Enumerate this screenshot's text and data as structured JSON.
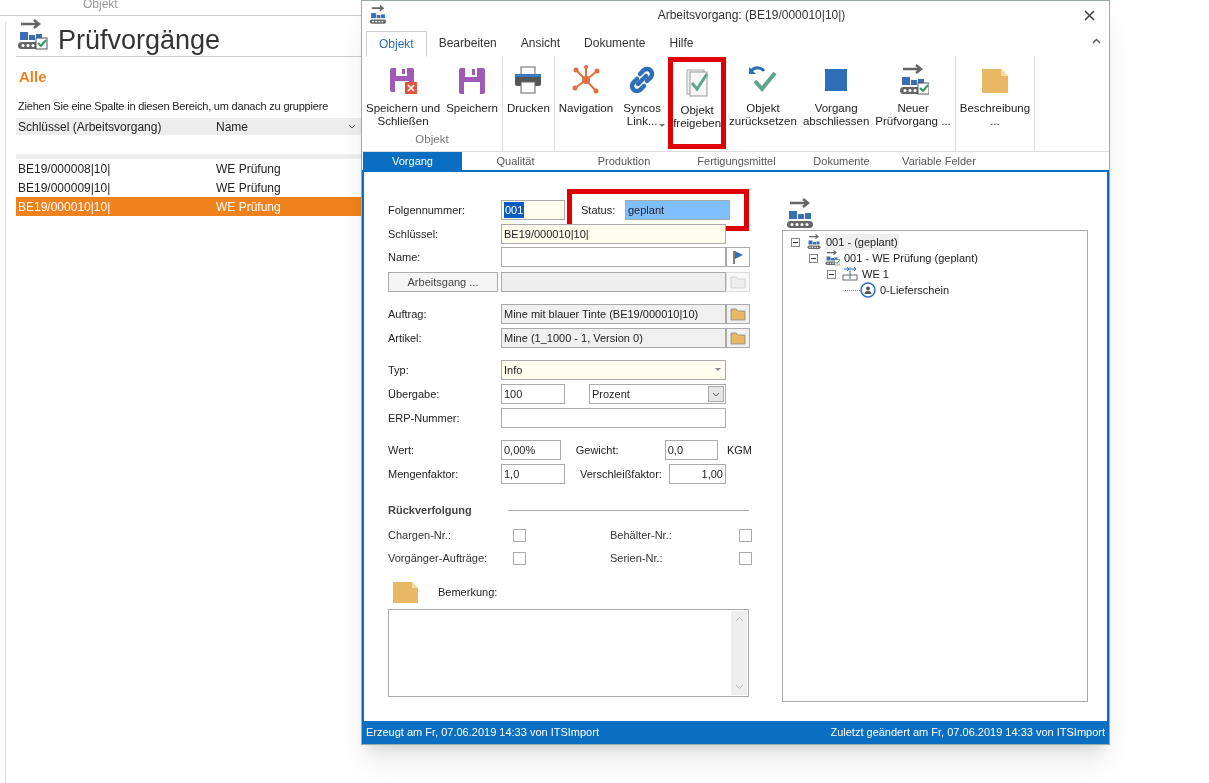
{
  "background": {
    "header_tab": "Objekt",
    "title": "Prüfvorgänge",
    "filter": "Alle",
    "group_hint": "Ziehen Sie eine Spalte in diesen Bereich, um danach zu gruppiere",
    "columns": [
      "Schlüssel (Arbeitsvorgang)",
      "Name"
    ],
    "rows": [
      {
        "cells": [
          "BE19/000008|10|",
          "WE Prüfung"
        ],
        "selected": false
      },
      {
        "cells": [
          "BE19/000009|10|",
          "WE Prüfung"
        ],
        "selected": false
      },
      {
        "cells": [
          "BE19/000010|10|",
          "WE Prüfung"
        ],
        "selected": true
      }
    ]
  },
  "dialog": {
    "title": "Arbeitsvorgang:  (BE19/000010|10|)",
    "ribbon_tabs": [
      {
        "label": "Objekt",
        "selected": true
      },
      {
        "label": "Bearbeiten",
        "selected": false
      },
      {
        "label": "Ansicht",
        "selected": false
      },
      {
        "label": "Dokumente",
        "selected": false
      },
      {
        "label": "Hilfe",
        "selected": false
      }
    ],
    "ribbon_groups": [
      {
        "label": "Objekt",
        "buttons": [
          {
            "kind": "save_close",
            "label": "Speichern und\nSchließen",
            "highlighted": false
          },
          {
            "kind": "save",
            "label": "Speichern",
            "highlighted": false
          }
        ]
      },
      {
        "buttons": [
          {
            "kind": "print",
            "label": "Drucken",
            "highlighted": false
          }
        ]
      },
      {
        "buttons": [
          {
            "kind": "navigation",
            "label": "Navigation",
            "highlighted": false
          },
          {
            "kind": "link",
            "label": "Syncos\nLink...",
            "dropdown": true,
            "highlighted": false
          },
          {
            "kind": "release",
            "label": "Objekt\nfreigeben",
            "highlighted": true
          },
          {
            "kind": "reset",
            "label": "Objekt\nzurücksetzen",
            "highlighted": false
          },
          {
            "kind": "finish",
            "label": "Vorgang\nabschliessen",
            "highlighted": false
          },
          {
            "kind": "new",
            "label": "Neuer\nPrüfvorgang ...",
            "highlighted": false
          }
        ]
      },
      {
        "buttons": [
          {
            "kind": "note",
            "label": "Beschreibung\n...",
            "highlighted": false
          }
        ]
      }
    ],
    "sub_tabs": [
      {
        "label": "Vorgang",
        "selected": true
      },
      {
        "label": "Qualität",
        "selected": false
      },
      {
        "label": "Produktion",
        "selected": false
      },
      {
        "label": "Fertigungsmittel",
        "selected": false
      },
      {
        "label": "Dokumente",
        "selected": false
      },
      {
        "label": "Variable Felder",
        "selected": false
      }
    ],
    "form": {
      "sequence": {
        "label": "Folgennummer:",
        "value": "001"
      },
      "status": {
        "label": "Status:",
        "value": "geplant",
        "highlighted": true
      },
      "key": {
        "label": "Schlüssel:",
        "value": "BE19/000010|10|"
      },
      "name": {
        "label": "Name:"
      },
      "operation_button": "Arbeitsgang ...",
      "order": {
        "label": "Auftrag:",
        "value": "Mine mit blauer Tinte (BE19/000010|10)"
      },
      "article": {
        "label": "Artikel:",
        "value": "Mine (1_1000 - 1, Version 0)"
      },
      "type": {
        "label": "Typ:",
        "value": "Info"
      },
      "transfer": {
        "label": "Übergabe:",
        "value": "100",
        "unit": "Prozent"
      },
      "erp": {
        "label": "ERP-Nummer:"
      },
      "worth": {
        "label": "Wert:",
        "value": "0,00%"
      },
      "weight": {
        "label": "Gewicht:",
        "value": "0,0",
        "unit": "KGM"
      },
      "quantity_factor": {
        "label": "Mengenfaktor:",
        "value": "1,0"
      },
      "wear_factor": {
        "label": "Verschleißfaktor:",
        "value": "1,00"
      },
      "traceability": {
        "title": "Rückverfolgung",
        "options": [
          {
            "label": "Chargen-Nr.:",
            "checked": false
          },
          {
            "label": "Behälter-Nr.:",
            "checked": false
          },
          {
            "label": "Vorgänger-Aufträge:",
            "checked": false
          },
          {
            "label": "Serien-Nr.:",
            "checked": false
          }
        ]
      },
      "remark": {
        "label": "Bemerkung:"
      }
    },
    "tree": [
      {
        "kind": "operation",
        "label": "001 -  (geplant)",
        "expanded": true,
        "selected": true,
        "children": [
          {
            "kind": "inspection",
            "label": "001 - WE Prüfung (geplant)",
            "expanded": true,
            "selected": false,
            "children": [
              {
                "kind": "step",
                "label": "WE 1",
                "expanded": true,
                "selected": false,
                "children": [
                  {
                    "kind": "document",
                    "label": "0-Lieferschein",
                    "selected": false
                  }
                ]
              }
            ]
          }
        ]
      }
    ],
    "status_left": "Erzeugt am Fr, 07.06.2019  14:33 von ITSImport",
    "status_right": "Zuletzt geändert am Fr, 07.06.2019  14:33 von ITSImport"
  }
}
